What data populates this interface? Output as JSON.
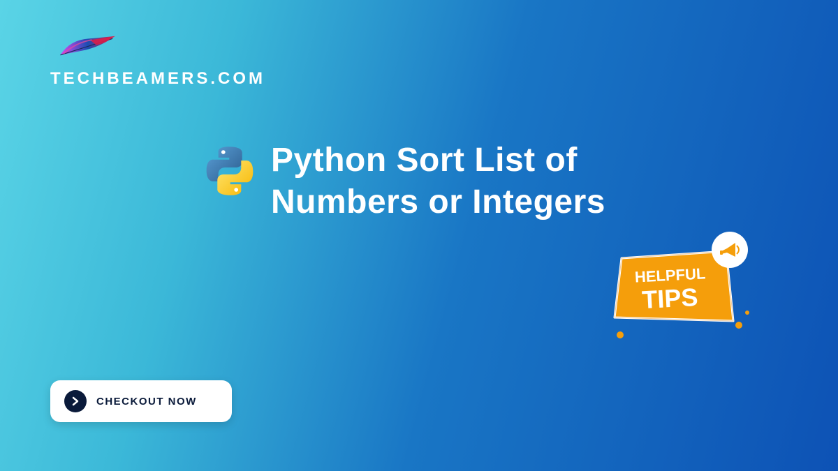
{
  "brand": {
    "name": "TECHBEAMERS.COM"
  },
  "hero": {
    "title": "Python Sort List of Numbers or Integers"
  },
  "tips": {
    "line1": "HELPFUL",
    "line2": "TIPS"
  },
  "cta": {
    "label": "CHECKOUT NOW"
  }
}
